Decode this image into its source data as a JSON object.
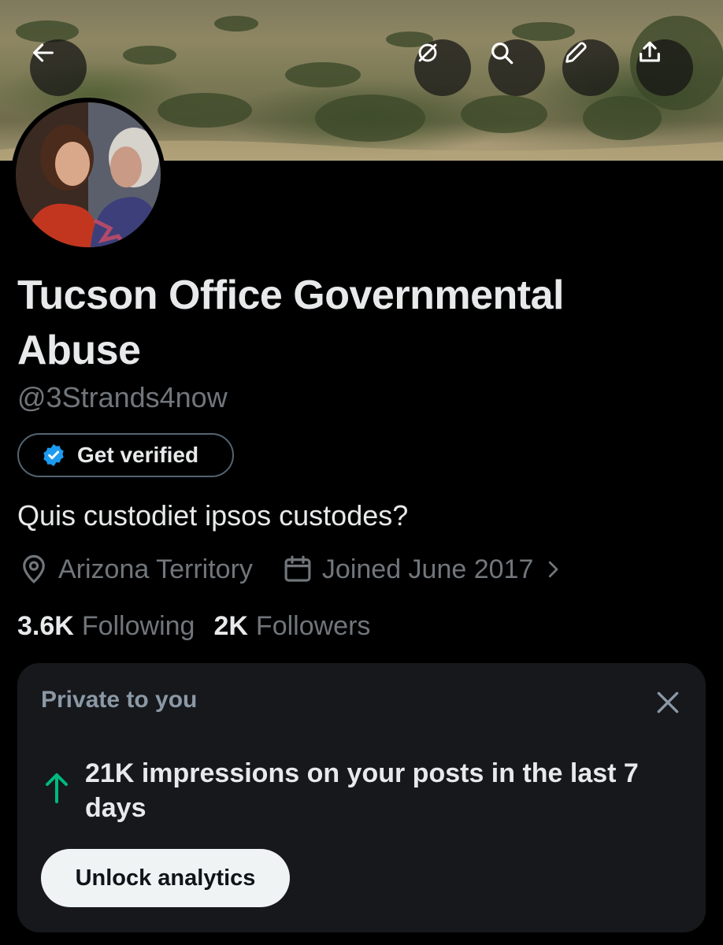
{
  "header": {
    "back_icon": "arrow-left-icon",
    "actions": [
      "circle-slash-icon",
      "search-icon",
      "pencil-icon",
      "share-icon"
    ]
  },
  "profile": {
    "name": "Tucson Office Governmental Abuse",
    "handle": "@3Strands4now",
    "verify_button_label": "Get verified",
    "bio": "Quis custodiet ipsos custodes?",
    "location": "Arizona Territory",
    "joined": "Joined June 2017",
    "following_count": "3.6K",
    "following_label": "Following",
    "followers_count": "2K",
    "followers_label": "Followers"
  },
  "private_card": {
    "title": "Private to you",
    "headline": "21K impressions on your posts in the last 7 days",
    "unlock_label": "Unlock analytics"
  },
  "colors": {
    "background": "#000000",
    "text_primary": "#e7e9ea",
    "text_secondary": "#71767b",
    "card_bg": "#16181c",
    "verified_blue": "#1d9bf0",
    "trend_green": "#00ba7c"
  }
}
